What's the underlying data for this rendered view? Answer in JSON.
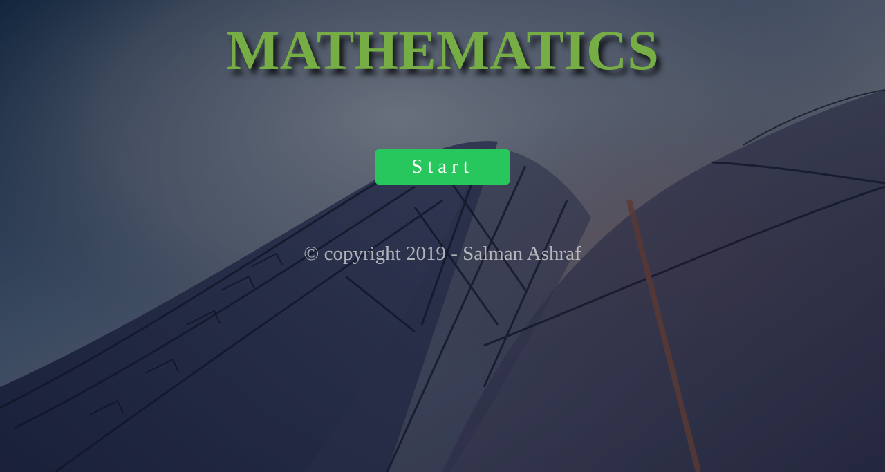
{
  "page": {
    "title": "MATHEMATICS",
    "start_label": "Start",
    "copyright": "© copyright 2019 - Salman Ashraf"
  },
  "colors": {
    "title": "#76ad44",
    "button": "#27c75e",
    "button_text": "#ffffff",
    "copyright_text": "#d7d7d7"
  },
  "background": {
    "description_icon": "architecture-photo-background"
  }
}
